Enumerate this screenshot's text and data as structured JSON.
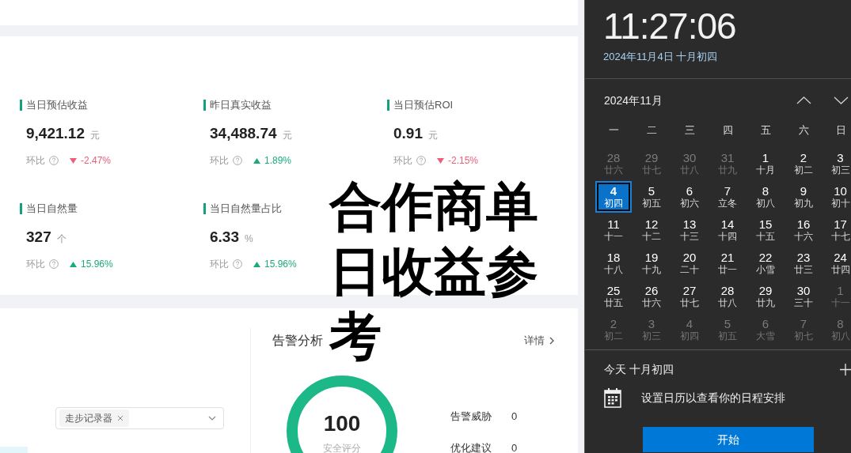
{
  "overlay_caption": {
    "lines": [
      "合作商单",
      "日收益参",
      "考"
    ]
  },
  "dashboard": {
    "metrics": [
      {
        "title": "当日预估收益",
        "value": "9,421.12",
        "unit": "元",
        "compare_label": "环比",
        "increase": false,
        "change": "-2.47%"
      },
      {
        "title": "昨日真实收益",
        "value": "34,488.74",
        "unit": "元",
        "compare_label": "环比",
        "increase": true,
        "change": "1.89%"
      },
      {
        "title": "当日预估ROI",
        "value": "0.91",
        "unit": "元",
        "compare_label": "环比",
        "increase": false,
        "change": "-2.15%"
      },
      {
        "title": "当日自然量",
        "value": "327",
        "unit": "个",
        "compare_label": "环比",
        "increase": true,
        "change": "15.96%"
      },
      {
        "title": "当日自然量占比",
        "value": "6.33",
        "unit": "%",
        "compare_label": "环比",
        "increase": true,
        "change": "15.96%"
      }
    ],
    "filter": {
      "tags": [
        "走步记录器"
      ]
    },
    "alerts": {
      "title": "告警分析",
      "link": "详情",
      "score": "100",
      "score_label": "安全评分",
      "rows": [
        {
          "label": "告警威胁",
          "value": "0"
        },
        {
          "label": "优化建议",
          "value": "0"
        }
      ]
    }
  },
  "calendar": {
    "time": "11:27:06",
    "date": "2024年11月4日 十月初四",
    "month": "2024年11月",
    "weekdays": [
      "一",
      "二",
      "三",
      "四",
      "五",
      "六",
      "日"
    ],
    "days": [
      {
        "day": "28",
        "lunar": "廿六",
        "outside_month": true,
        "selected": false
      },
      {
        "day": "29",
        "lunar": "廿七",
        "outside_month": true,
        "selected": false
      },
      {
        "day": "30",
        "lunar": "廿八",
        "outside_month": true,
        "selected": false
      },
      {
        "day": "31",
        "lunar": "廿九",
        "outside_month": true,
        "selected": false
      },
      {
        "day": "1",
        "lunar": "十月",
        "outside_month": false,
        "selected": false
      },
      {
        "day": "2",
        "lunar": "初二",
        "outside_month": false,
        "selected": false
      },
      {
        "day": "3",
        "lunar": "初三",
        "outside_month": false,
        "selected": false
      },
      {
        "day": "4",
        "lunar": "初四",
        "outside_month": false,
        "selected": true
      },
      {
        "day": "5",
        "lunar": "初五",
        "outside_month": false,
        "selected": false
      },
      {
        "day": "6",
        "lunar": "初六",
        "outside_month": false,
        "selected": false
      },
      {
        "day": "7",
        "lunar": "立冬",
        "outside_month": false,
        "selected": false
      },
      {
        "day": "8",
        "lunar": "初八",
        "outside_month": false,
        "selected": false
      },
      {
        "day": "9",
        "lunar": "初九",
        "outside_month": false,
        "selected": false
      },
      {
        "day": "10",
        "lunar": "初十",
        "outside_month": false,
        "selected": false
      },
      {
        "day": "11",
        "lunar": "十一",
        "outside_month": false,
        "selected": false
      },
      {
        "day": "12",
        "lunar": "十二",
        "outside_month": false,
        "selected": false
      },
      {
        "day": "13",
        "lunar": "十三",
        "outside_month": false,
        "selected": false
      },
      {
        "day": "14",
        "lunar": "十四",
        "outside_month": false,
        "selected": false
      },
      {
        "day": "15",
        "lunar": "十五",
        "outside_month": false,
        "selected": false
      },
      {
        "day": "16",
        "lunar": "十六",
        "outside_month": false,
        "selected": false
      },
      {
        "day": "17",
        "lunar": "十七",
        "outside_month": false,
        "selected": false
      },
      {
        "day": "18",
        "lunar": "十八",
        "outside_month": false,
        "selected": false
      },
      {
        "day": "19",
        "lunar": "十九",
        "outside_month": false,
        "selected": false
      },
      {
        "day": "20",
        "lunar": "二十",
        "outside_month": false,
        "selected": false
      },
      {
        "day": "21",
        "lunar": "廿一",
        "outside_month": false,
        "selected": false
      },
      {
        "day": "22",
        "lunar": "小雪",
        "outside_month": false,
        "selected": false
      },
      {
        "day": "23",
        "lunar": "廿三",
        "outside_month": false,
        "selected": false
      },
      {
        "day": "24",
        "lunar": "廿四",
        "outside_month": false,
        "selected": false
      },
      {
        "day": "25",
        "lunar": "廿五",
        "outside_month": false,
        "selected": false
      },
      {
        "day": "26",
        "lunar": "廿六",
        "outside_month": false,
        "selected": false
      },
      {
        "day": "27",
        "lunar": "廿七",
        "outside_month": false,
        "selected": false
      },
      {
        "day": "28",
        "lunar": "廿八",
        "outside_month": false,
        "selected": false
      },
      {
        "day": "29",
        "lunar": "廿九",
        "outside_month": false,
        "selected": false
      },
      {
        "day": "30",
        "lunar": "三十",
        "outside_month": false,
        "selected": false
      },
      {
        "day": "1",
        "lunar": "十一",
        "outside_month": true,
        "selected": false
      },
      {
        "day": "2",
        "lunar": "初二",
        "outside_month": true,
        "selected": false
      },
      {
        "day": "3",
        "lunar": "初三",
        "outside_month": true,
        "selected": false
      },
      {
        "day": "4",
        "lunar": "初四",
        "outside_month": true,
        "selected": false
      },
      {
        "day": "5",
        "lunar": "初五",
        "outside_month": true,
        "selected": false
      },
      {
        "day": "6",
        "lunar": "大雪",
        "outside_month": true,
        "selected": false
      },
      {
        "day": "7",
        "lunar": "初七",
        "outside_month": true,
        "selected": false
      },
      {
        "day": "8",
        "lunar": "初八",
        "outside_month": true,
        "selected": false
      }
    ],
    "agenda": {
      "title": "今天 十月初四",
      "message": "设置日历以查看你的日程安排",
      "button": "开始"
    }
  }
}
